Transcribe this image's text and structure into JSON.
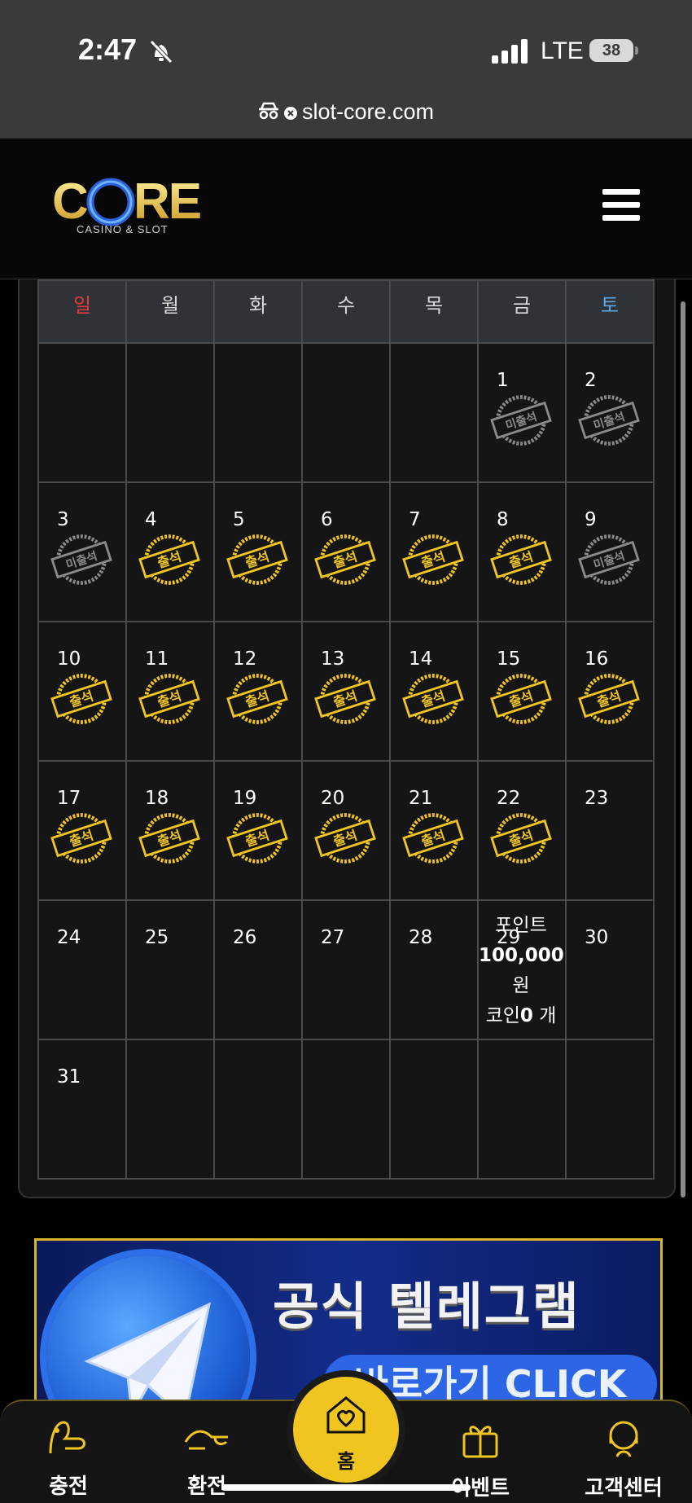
{
  "status": {
    "time": "2:47",
    "network": "LTE",
    "battery": "38"
  },
  "browser": {
    "url": "slot-core.com"
  },
  "header": {
    "logo_text": "CORE",
    "logo_sub": "CASINO & SLOT"
  },
  "calendar": {
    "weekdays": [
      "일",
      "월",
      "화",
      "수",
      "목",
      "금",
      "토"
    ],
    "attended_label": "출석",
    "missed_label": "미출석",
    "days": {
      "d1": "1",
      "d2": "2",
      "d3": "3",
      "d4": "4",
      "d5": "5",
      "d6": "6",
      "d7": "7",
      "d8": "8",
      "d9": "9",
      "d10": "10",
      "d11": "11",
      "d12": "12",
      "d13": "13",
      "d14": "14",
      "d15": "15",
      "d16": "16",
      "d17": "17",
      "d18": "18",
      "d19": "19",
      "d20": "20",
      "d21": "21",
      "d22": "22",
      "d23": "23",
      "d24": "24",
      "d25": "25",
      "d26": "26",
      "d27": "27",
      "d28": "28",
      "d29": "29",
      "d30": "30",
      "d31": "31"
    },
    "points": {
      "label": "포인트",
      "amount": "100,000",
      "unit": "원",
      "coin_label": "코인",
      "coin_count": "0",
      "coin_unit": "개"
    },
    "attendance": {
      "missed": [
        1,
        2,
        3,
        9
      ],
      "attended": [
        4,
        5,
        6,
        7,
        8,
        10,
        11,
        12,
        13,
        14,
        15,
        16,
        17,
        18,
        19,
        20,
        21,
        22
      ]
    }
  },
  "banner": {
    "title": "공식 텔레그램",
    "subtitle": "바로가기 CLICK"
  },
  "bottom_nav": {
    "charge": "충전",
    "exchange": "환전",
    "home": "홈",
    "event": "이벤트",
    "support": "고객센터"
  },
  "colors": {
    "gold": "#f0c520",
    "sunday": "#e23b3b",
    "saturday": "#5fa8e8"
  }
}
